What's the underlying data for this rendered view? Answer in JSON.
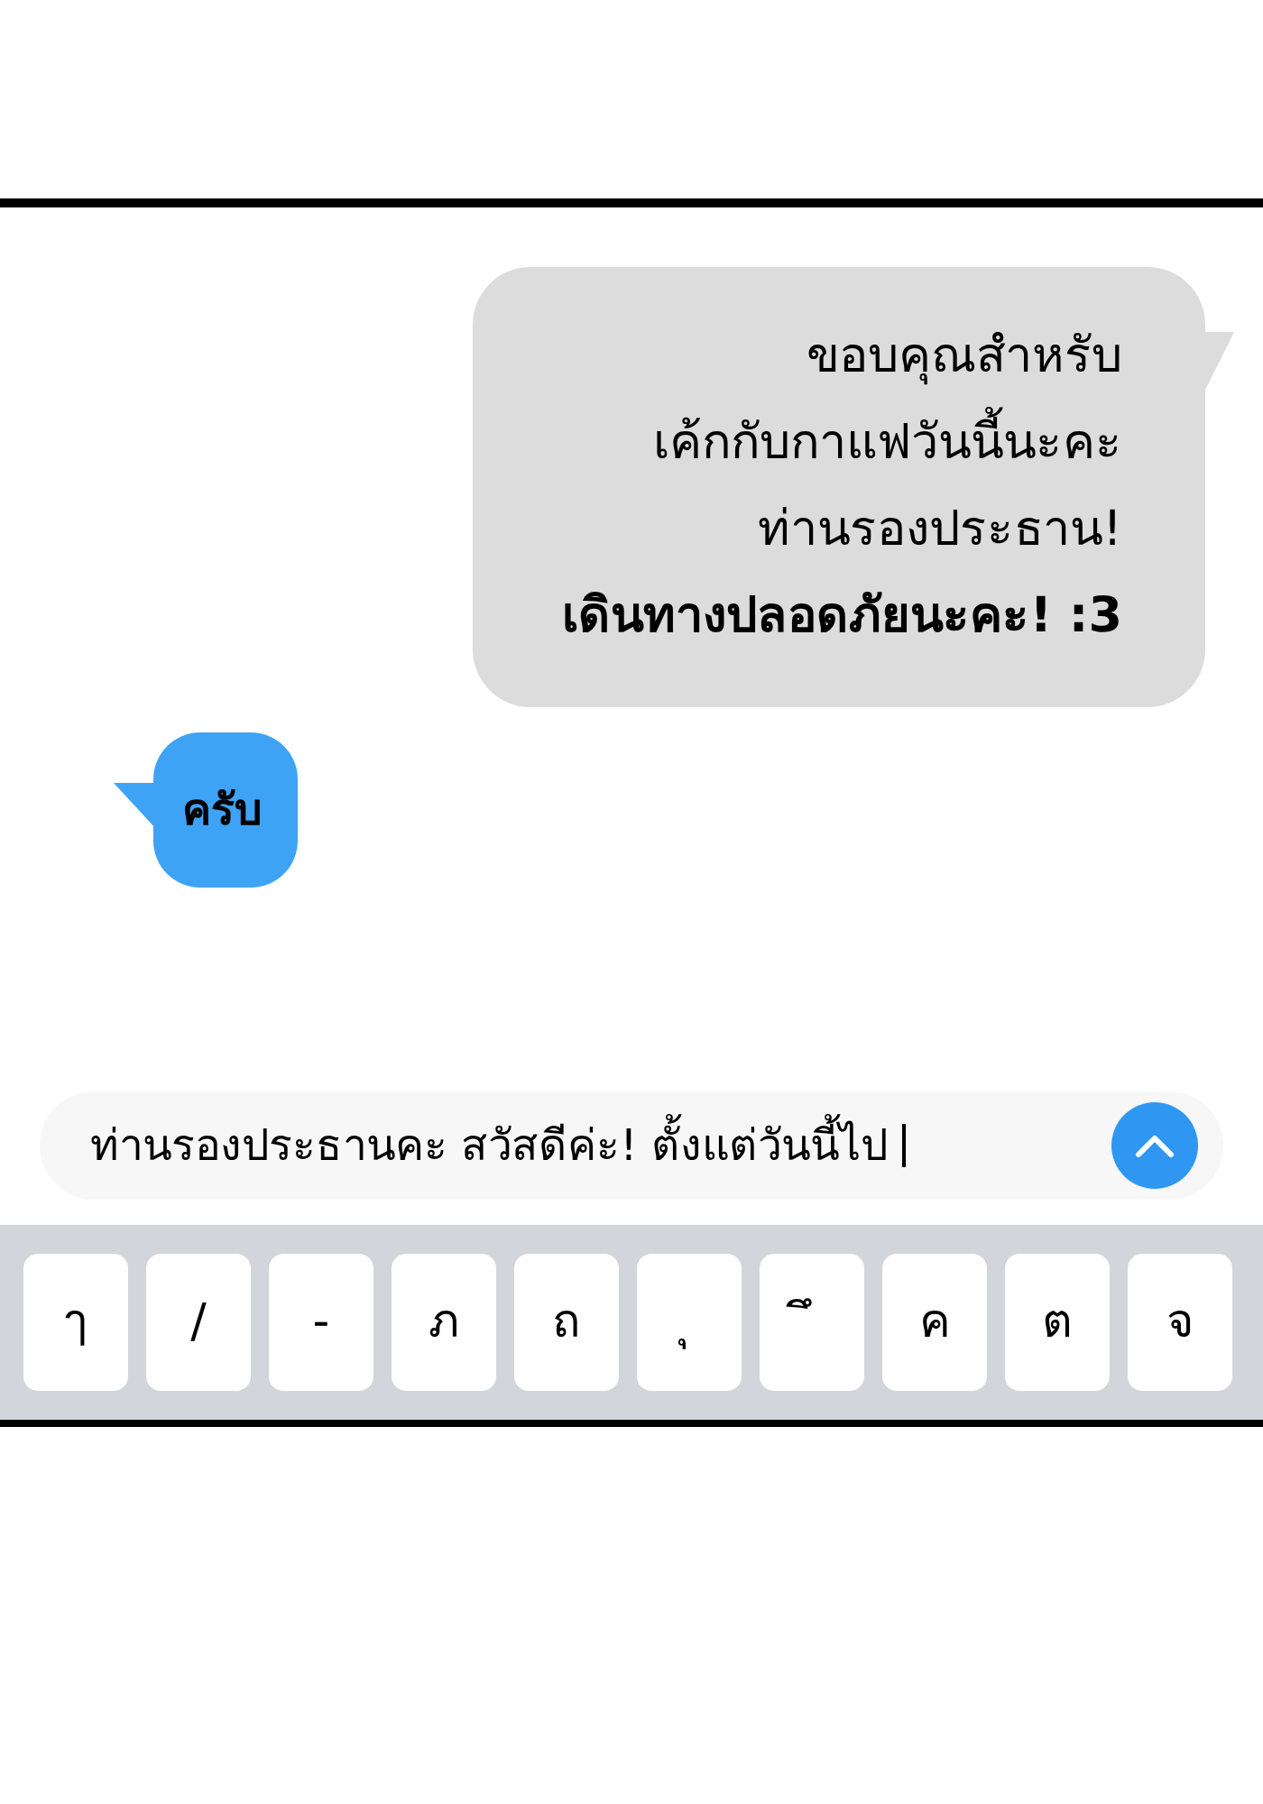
{
  "messages": [
    {
      "kind": "outgoing",
      "lines": [
        {
          "text": "ขอบคุณสำหรับ",
          "bold": false
        },
        {
          "text": "เค้กกับกาแฟวันนี้นะคะ",
          "bold": false
        },
        {
          "text": "ท่านรองประธาน!",
          "bold": false
        },
        {
          "text": "เดินทางปลอดภัยนะคะ! :3",
          "bold": true
        }
      ]
    },
    {
      "kind": "incoming",
      "lines": [
        {
          "text": "ครับ",
          "bold": true
        }
      ]
    }
  ],
  "composer": {
    "value": "ท่านรองประธานคะ สวัสดีค่ะ! ตั้งแต่วันนี้ไป"
  },
  "keyboard": {
    "keys": [
      "ๅ",
      "/",
      "-",
      "ภ",
      "ถ",
      "ุ",
      "ึ",
      "ค",
      "ต",
      "จ"
    ]
  }
}
